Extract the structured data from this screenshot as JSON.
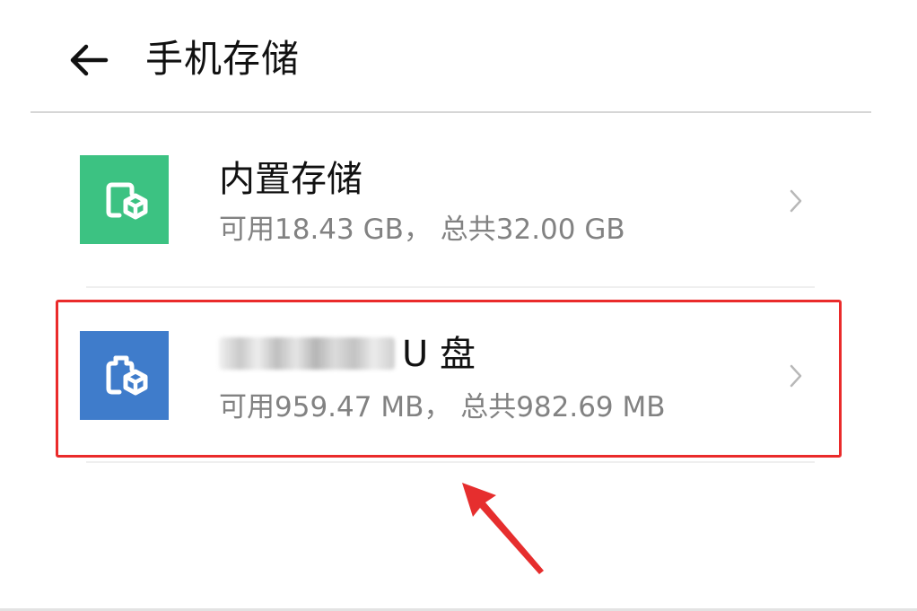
{
  "header": {
    "title": "手机存储",
    "back_icon": "arrow-left-icon"
  },
  "storage": {
    "items": [
      {
        "title": "内置存储",
        "detail": "可用18.43 GB， 总共32.00 GB",
        "icon": "internal-storage-icon",
        "icon_color": "#3cc282"
      },
      {
        "title_suffix": "U 盘",
        "detail": "可用959.47 MB， 总共982.69 MB",
        "icon": "usb-storage-icon",
        "icon_color": "#3f7ccb"
      }
    ],
    "chevron_icon": "chevron-right-icon"
  },
  "annotation": {
    "highlight_color": "#ea2b2b",
    "arrow_color": "#e62e2e"
  }
}
